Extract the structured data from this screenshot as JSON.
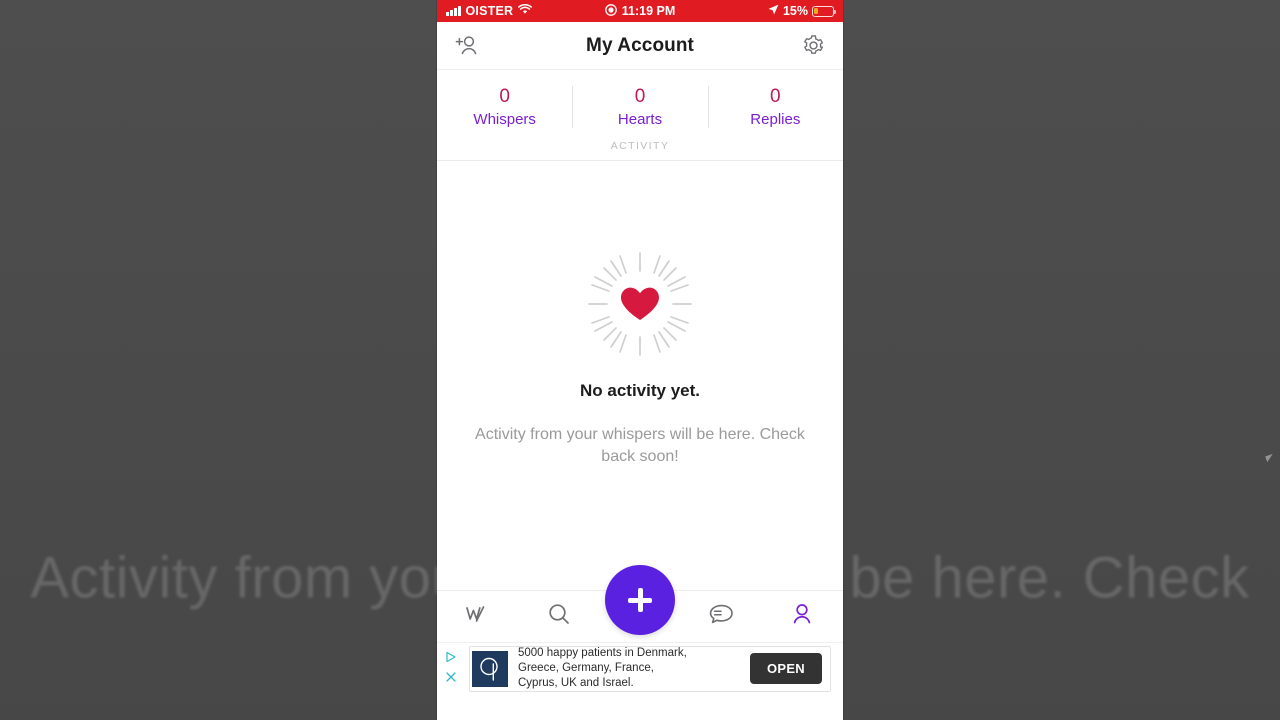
{
  "backdrop": {
    "text": "Activity from your whispers will be here. Check",
    "color": "#4b4b4b"
  },
  "status_bar": {
    "carrier": "OISTER",
    "time": "11:19 PM",
    "battery_percent": "15%",
    "background_color": "#e01b22",
    "icons": {
      "signal": "signal-bars-icon",
      "wifi": "wifi-icon",
      "recording": "screen-recording-icon",
      "location": "location-arrow-icon",
      "battery": "battery-low-icon"
    }
  },
  "header": {
    "title": "My Account",
    "left_icon": "add-person-icon",
    "right_icon": "gear-icon"
  },
  "stats": {
    "items": [
      {
        "value": "0",
        "label": "Whispers"
      },
      {
        "value": "0",
        "label": "Hearts"
      },
      {
        "value": "0",
        "label": "Replies"
      }
    ],
    "value_color": "#c2185b",
    "label_color": "#7a1fd4"
  },
  "section": {
    "activity_label": "ACTIVITY"
  },
  "empty_state": {
    "illustration": "heart-burst-icon",
    "heart_color": "#d6193f",
    "ray_color": "#cfcfcf",
    "title": "No activity yet.",
    "subtitle": "Activity from your whispers will be here. Check back soon!"
  },
  "bottom_nav": {
    "items": [
      {
        "name": "whisper-logo-icon",
        "label": "Whisper",
        "active": false
      },
      {
        "name": "search-icon",
        "label": "Search",
        "active": false
      },
      {
        "name": "chat-bubbles-icon",
        "label": "Chats",
        "active": false
      },
      {
        "name": "profile-icon",
        "label": "Profile",
        "active": true
      }
    ],
    "fab": {
      "name": "compose-fab",
      "label": "+",
      "color": "#5b21e0"
    },
    "active_color": "#7a1fd4",
    "inactive_color": "#6e6e73"
  },
  "ad": {
    "adchoices_icon": "adchoices-triangle-icon",
    "close_icon": "close-icon",
    "logo_icon": "advertiser-logo-icon",
    "line1": "5000 happy patients in Denmark,",
    "line2": "Greece, Germany, France,",
    "line3": "Cyprus, UK and Israel.",
    "cta_label": "OPEN"
  }
}
